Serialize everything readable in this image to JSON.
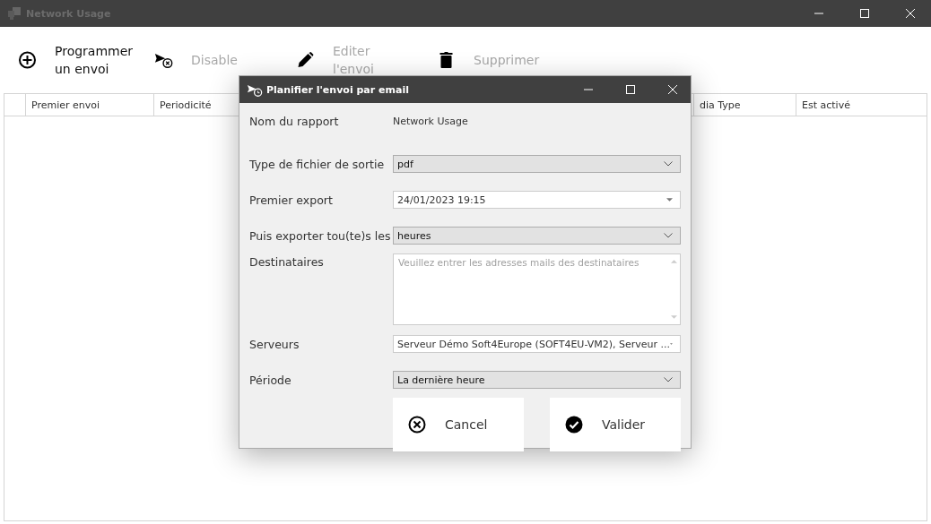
{
  "window": {
    "title": "Network Usage"
  },
  "toolbar": [
    {
      "label": "Programmer un envoi",
      "disabled": false
    },
    {
      "label": "Disable",
      "disabled": true
    },
    {
      "label": "Editer l'envoi",
      "disabled": true
    },
    {
      "label": "Supprimer",
      "disabled": true
    }
  ],
  "table": {
    "columns": [
      {
        "label": "Premier envoi"
      },
      {
        "label": "Periodicité"
      },
      {},
      {
        "label": "dia Type"
      },
      {
        "label": "Est activé"
      }
    ]
  },
  "dialog": {
    "title": "Planifier l'envoi par email",
    "fields": [
      {
        "kind": "text",
        "label": "Nom du rapport",
        "value": "Network Usage"
      },
      {
        "kind": "select",
        "label": "Type de fichier de sortie",
        "value": "pdf"
      },
      {
        "kind": "datetime",
        "label": "Premier export",
        "value": "24/01/2023 19:15"
      },
      {
        "kind": "select",
        "label": "Puis exporter tou(te)s les",
        "value": "heures"
      },
      {
        "kind": "textarea",
        "label": "Destinataires",
        "placeholder": "Veuillez entrer les adresses mails des destinataires"
      },
      {
        "kind": "multiselect",
        "label": "Serveurs",
        "value": "Serveur Démo Soft4Europe (SOFT4EU-VM2), Serveur ..."
      },
      {
        "kind": "select",
        "label": "Période",
        "value": "La dernière heure"
      }
    ],
    "buttons": [
      {
        "label": "Cancel"
      },
      {
        "label": "Valider"
      }
    ]
  }
}
